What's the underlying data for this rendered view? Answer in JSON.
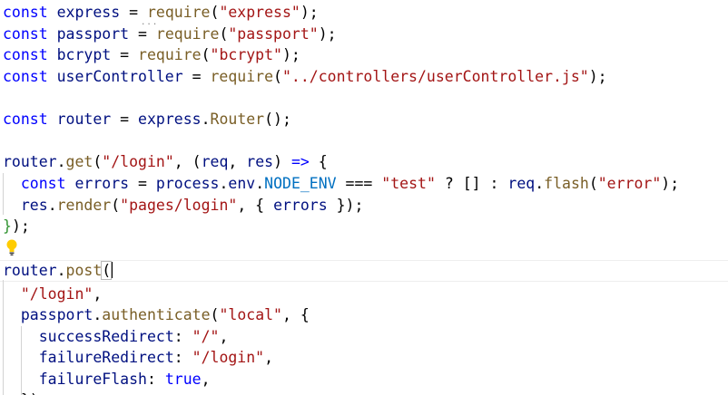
{
  "editor": {
    "language": "javascript",
    "colors": {
      "keyword": "#0000ff",
      "variable": "#001080",
      "function": "#795e26",
      "string": "#a31515",
      "constant": "#0070c1",
      "bracket_pair": "#319331",
      "lightbulb": "#ffcc00"
    },
    "hint_dots": "...",
    "lightbulb_icon": "lightbulb-icon",
    "code": {
      "l1": {
        "t1": "const",
        "t2": " express ",
        "t3": "=",
        "t4": " ",
        "t5": "require",
        "t6": "(",
        "t7": "\"express\"",
        "t8": ");"
      },
      "l2": {
        "t1": "const",
        "t2": " passport ",
        "t3": "=",
        "t4": " ",
        "t5": "require",
        "t6": "(",
        "t7": "\"passport\"",
        "t8": ");"
      },
      "l3": {
        "t1": "const",
        "t2": " bcrypt ",
        "t3": "=",
        "t4": " ",
        "t5": "require",
        "t6": "(",
        "t7": "\"bcrypt\"",
        "t8": ");"
      },
      "l4": {
        "t1": "const",
        "t2": " userController ",
        "t3": "=",
        "t4": " ",
        "t5": "require",
        "t6": "(",
        "t7": "\"../controllers/userController.js\"",
        "t8": ");"
      },
      "l6": {
        "t1": "const",
        "t2": " router ",
        "t3": "=",
        "t4": " express",
        "t5": ".",
        "t6": "Router",
        "t7": "();"
      },
      "l8": {
        "t1": "router",
        "t2": ".",
        "t3": "get",
        "t4": "(",
        "t5": "\"/login\"",
        "t6": ", (",
        "t7": "req",
        "t8": ", ",
        "t9": "res",
        "t10": ") ",
        "t11": "=>",
        "t12": " ",
        "t13": "{"
      },
      "l9": {
        "t1": "  ",
        "t2": "const",
        "t3": " errors ",
        "t4": "=",
        "t5": " process",
        "t6": ".",
        "t7": "env",
        "t8": ".",
        "t9": "NODE_ENV",
        "t10": " === ",
        "t11": "\"test\"",
        "t12": " ? [] : ",
        "t13": "req",
        "t14": ".",
        "t15": "flash",
        "t16": "(",
        "t17": "\"error\"",
        "t18": ");"
      },
      "l10": {
        "t1": "  ",
        "t2": "res",
        "t3": ".",
        "t4": "render",
        "t5": "(",
        "t6": "\"pages/login\"",
        "t7": ", { ",
        "t8": "errors",
        "t9": " });"
      },
      "l11": {
        "t1": "}",
        "t2": ");"
      },
      "l13": {
        "t1": "router",
        "t2": ".",
        "t3": "post",
        "t4": "("
      },
      "l14": {
        "t1": "  ",
        "t2": "\"/login\"",
        "t3": ","
      },
      "l15": {
        "t1": "  ",
        "t2": "passport",
        "t3": ".",
        "t4": "authenticate",
        "t5": "(",
        "t6": "\"local\"",
        "t7": ", {"
      },
      "l16": {
        "t1": "    ",
        "t2": "successRedirect",
        "t3": ": ",
        "t4": "\"/\"",
        "t5": ","
      },
      "l17": {
        "t1": "    ",
        "t2": "failureRedirect",
        "t3": ": ",
        "t4": "\"/login\"",
        "t5": ","
      },
      "l18": {
        "t1": "    ",
        "t2": "failureFlash",
        "t3": ": ",
        "t4": "true",
        "t5": ","
      },
      "l19": {
        "t1": "  ",
        "t2": "}),"
      }
    }
  }
}
